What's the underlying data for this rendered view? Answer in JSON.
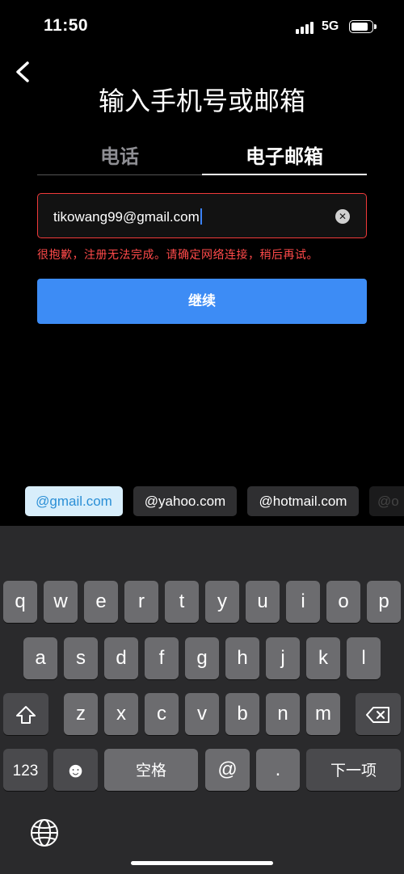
{
  "status_bar": {
    "time": "11:50",
    "network": "5G"
  },
  "header": {
    "title": "输入手机号或邮箱"
  },
  "tabs": {
    "phone": "电话",
    "email": "电子邮箱"
  },
  "form": {
    "email_value": "tikowang99@gmail.com",
    "error": "很抱歉，注册无法完成。请确定网络连接，稍后再试。",
    "continue_label": "继续"
  },
  "suggestions": [
    "@gmail.com",
    "@yahoo.com",
    "@hotmail.com",
    "@o"
  ],
  "keyboard": {
    "row1": [
      "q",
      "w",
      "e",
      "r",
      "t",
      "y",
      "u",
      "i",
      "o",
      "p"
    ],
    "row2": [
      "a",
      "s",
      "d",
      "f",
      "g",
      "h",
      "j",
      "k",
      "l"
    ],
    "row3": [
      "z",
      "x",
      "c",
      "v",
      "b",
      "n",
      "m"
    ],
    "numbers": "123",
    "emoji": "☻",
    "space": "空格",
    "at": "@",
    "dot": ".",
    "next": "下一项"
  },
  "colors": {
    "accent": "#3d8cf5",
    "error": "#f03a3a",
    "suggestion_active_bg": "#d8eefb"
  }
}
